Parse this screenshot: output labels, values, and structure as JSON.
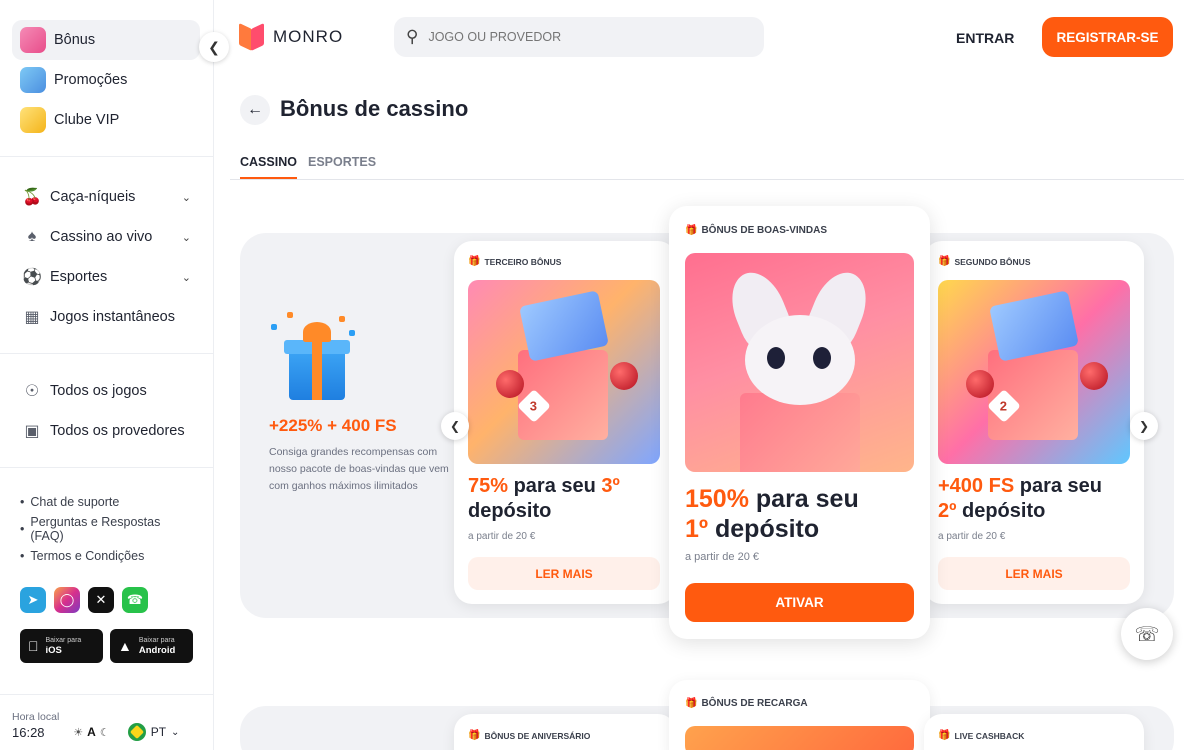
{
  "sidebar": {
    "top_items": [
      {
        "label": "Bônus",
        "icon": "gift-icon"
      },
      {
        "label": "Promoções",
        "icon": "megaphone-icon"
      },
      {
        "label": "Clube VIP",
        "icon": "crown-icon"
      }
    ],
    "nav_items": [
      {
        "label": "Caça-níqueis",
        "icon": "cherries-icon"
      },
      {
        "label": "Cassino ao vivo",
        "icon": "dealer-icon"
      },
      {
        "label": "Esportes",
        "icon": "ball-icon"
      },
      {
        "label": "Jogos instantâneos",
        "icon": "bar-chart-icon"
      }
    ],
    "all_items": [
      {
        "label": "Todos os jogos",
        "icon": "compass-icon"
      },
      {
        "label": "Todos os provedores",
        "icon": "grid-icon"
      }
    ],
    "links": [
      "Chat de suporte",
      "Perguntas e Respostas (FAQ)",
      "Termos e Condições"
    ],
    "apps": {
      "ios": {
        "small": "Baixar para",
        "big": "iOS"
      },
      "android": {
        "small": "Baixar para",
        "big": "Android"
      }
    },
    "footer": {
      "time_label": "Hora local",
      "time_value": "16:28",
      "theme_auto": "A",
      "language": "PT"
    }
  },
  "header": {
    "logo_text": "MONRO",
    "search_placeholder": "JOGO OU PROVEDOR",
    "login_label": "ENTRAR",
    "register_label": "REGISTRAR-SE"
  },
  "page": {
    "title": "Bônus de cassino",
    "tabs": [
      "CASSINO",
      "ESPORTES"
    ]
  },
  "intro": {
    "title": "+225% + 400 FS",
    "text": "Consiga grandes recompensas com nosso pacote de boas-vindas que vem com ganhos máximos ilimitados"
  },
  "cards": {
    "third": {
      "tag": "TERCEIRO BÔNUS",
      "title_hl1": "75%",
      "title_mid": " para seu ",
      "title_hl2": "3º",
      "title_end": "depósito",
      "min": "a partir de 20 €",
      "button": "LER MAIS",
      "badge": "3"
    },
    "welcome": {
      "tag": "BÔNUS DE BOAS-VINDAS",
      "title_hl1": "150%",
      "title_mid": " para seu",
      "title_hl2": "1º",
      "title_end": " depósito",
      "min": "a partir de 20 €",
      "button": "ATIVAR"
    },
    "second": {
      "tag": "SEGUNDO BÔNUS",
      "title_hl1": "+400 FS",
      "title_mid": " para seu",
      "title_hl2": "2º",
      "title_end": " depósito",
      "min": "a partir de 20 €",
      "button": "LER MAIS",
      "badge": "2"
    }
  },
  "bottom_cards": {
    "left_tag": "BÔNUS DE ANIVERSÁRIO",
    "center_tag": "BÔNUS DE RECARGA",
    "right_tag": "LIVE CASHBACK"
  },
  "colors": {
    "accent": "#ff5a0f",
    "panel": "#f1f2f5",
    "text": "#1f2330"
  }
}
